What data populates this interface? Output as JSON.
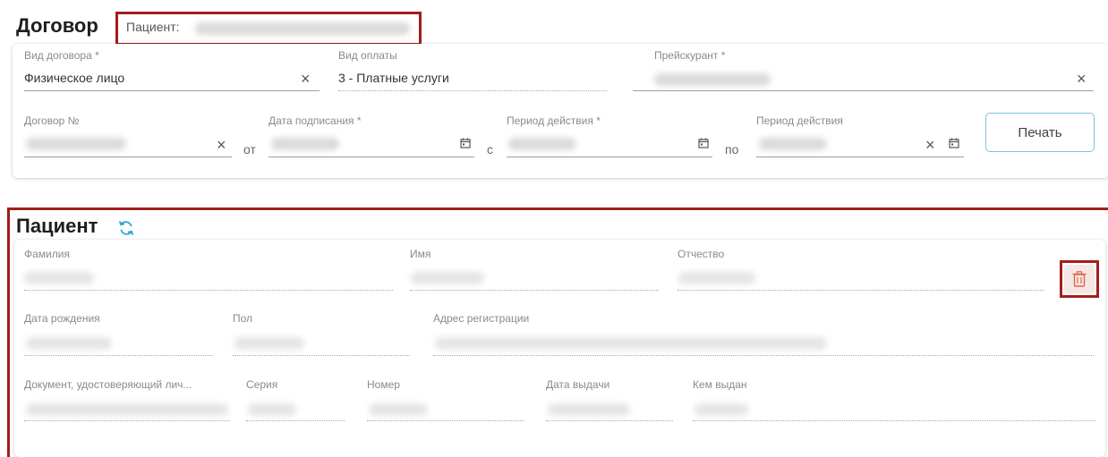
{
  "contract": {
    "title": "Договор",
    "patient_label": "Пациент:",
    "fields": {
      "contract_type": {
        "label": "Вид договора *",
        "value": "Физическое лицо"
      },
      "payment_type": {
        "label": "Вид оплаты",
        "value": "3 - Платные услуги"
      },
      "price_list": {
        "label": "Прейскурант *"
      },
      "contract_number": {
        "label": "Договор №"
      },
      "sign_date": {
        "label": "Дата подписания *"
      },
      "period_from": {
        "label": "Период действия *"
      },
      "period_to": {
        "label": "Период действия"
      }
    },
    "sep_from": "от",
    "sep_c": "с",
    "sep_to": "по",
    "print_label": "Печать"
  },
  "patient": {
    "title": "Пациент",
    "fields": {
      "last_name": "Фамилия",
      "first_name": "Имя",
      "patronymic": "Отчество",
      "birth_date": "Дата рождения",
      "sex": "Пол",
      "address": "Адрес регистрации",
      "document": "Документ, удостоверяющий лич...",
      "series": "Серия",
      "number": "Номер",
      "issue_date": "Дата выдачи",
      "issued_by": "Кем выдан"
    }
  },
  "colors": {
    "highlight": "#a31d1d",
    "accent": "#29a8d6",
    "delete": "#e0664f"
  },
  "icons": [
    "clear-icon",
    "calendar-icon",
    "refresh-icon",
    "trash-icon"
  ]
}
